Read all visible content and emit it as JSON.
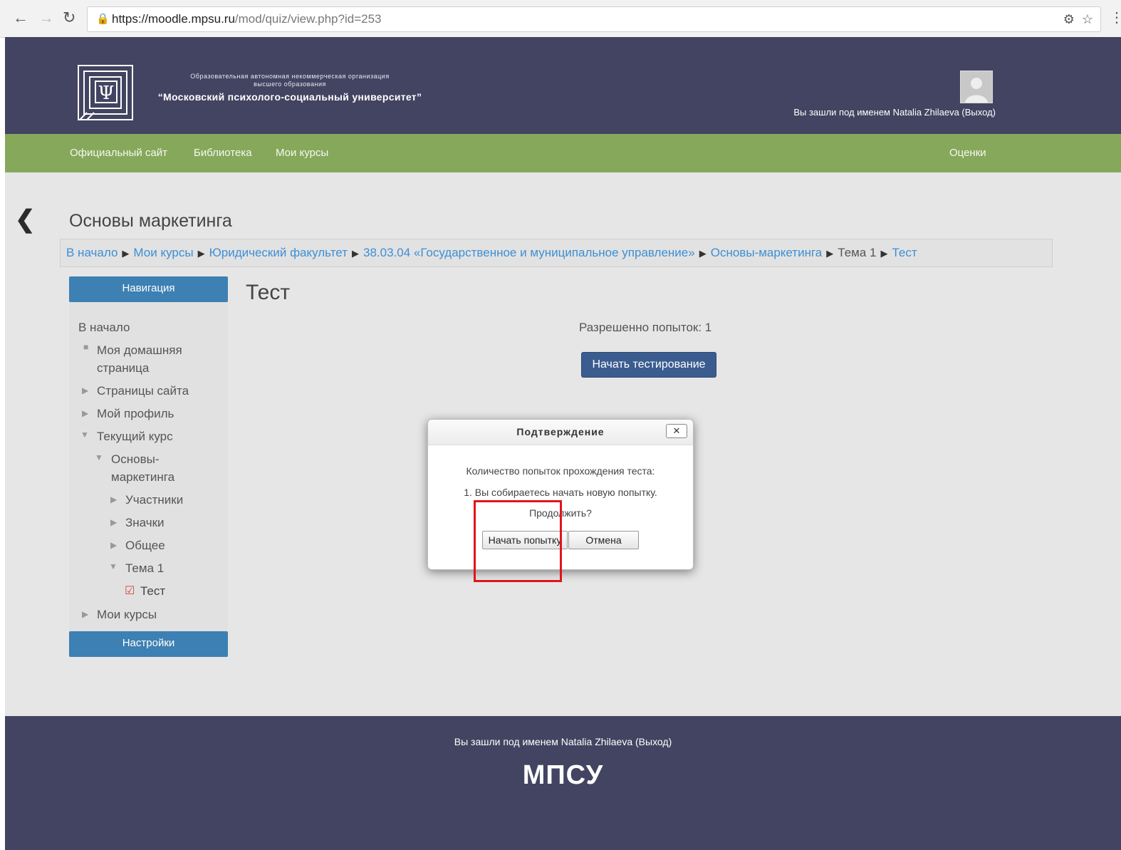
{
  "browser": {
    "url_host": "https://moodle.mpsu.ru",
    "url_path": "/mod/quiz/view.php?id=253"
  },
  "header": {
    "org_line1": "Образовательная автономная некоммерческая организация",
    "org_line2": "высшего образования",
    "org_name": "“Московский психолого-социальный университет”",
    "logged_in": "Вы зашли под именем Natalia Zhilaeva (Выход)"
  },
  "nav": {
    "official_site": "Официальный сайт",
    "library": "Библиотека",
    "my_courses": "Мои курсы",
    "grades": "Оценки"
  },
  "course_title": "Основы маркетинга",
  "breadcrumb": {
    "home": "В начало",
    "my_courses": "Мои курсы",
    "faculty": "Юридический факультет",
    "program": "38.03.04 «Государственное и муниципальное управление»",
    "course": "Основы-маркетинга",
    "topic": "Тема 1",
    "quiz": "Тест"
  },
  "sidebar": {
    "nav_header": "Навигация",
    "home": "В начало",
    "my_home_line1": "Моя домашняя",
    "my_home_line2": "страница",
    "site_pages": "Страницы сайта",
    "my_profile": "Мой профиль",
    "current_course": "Текущий курс",
    "course_line1": "Основы-",
    "course_line2": "маркетинга",
    "participants": "Участники",
    "badges": "Значки",
    "general": "Общее",
    "topic1": "Тема 1",
    "quiz": "Тест",
    "my_courses": "Мои курсы",
    "settings_header": "Настройки"
  },
  "main": {
    "title": "Тест",
    "attempts_allowed": "Разрешенно попыток: 1",
    "start_button": "Начать тестирование"
  },
  "dialog": {
    "title": "Подтверждение",
    "line1": "Количество попыток прохождения теста:",
    "line2": "1. Вы собираетесь начать новую попытку.",
    "line3": "Продолжить?",
    "start_attempt": "Начать попытку",
    "cancel": "Отмена"
  },
  "footer": {
    "logged_in": "Вы зашли под именем Natalia Zhilaeva (Выход)",
    "logo_text": "МПСУ"
  },
  "colors": {
    "header_bg": "#434461",
    "nav_green": "#86a85b",
    "block_blue": "#3d80b3",
    "button_blue": "#3b5c8f",
    "highlight_red": "#e0151a"
  }
}
